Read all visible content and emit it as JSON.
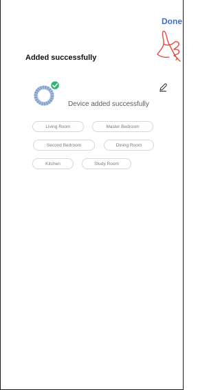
{
  "header": {
    "done_label": "Done"
  },
  "title": "Added successfully",
  "device": {
    "message": "Device added successfully",
    "icon": "device-ring-icon",
    "status_icon": "checkmark-icon",
    "edit_icon": "pencil-icon"
  },
  "rooms": [
    {
      "label": "Living Room"
    },
    {
      "label": "Master Bedroom"
    },
    {
      "label": "Second Bedroom"
    },
    {
      "label": "Dining Room"
    },
    {
      "label": "Kitchen"
    },
    {
      "label": "Study Room"
    }
  ],
  "colors": {
    "accent": "#3a6fd8",
    "success": "#2bb673",
    "annotation": "#e24a3b",
    "device_ring": "#8aa6cf"
  }
}
